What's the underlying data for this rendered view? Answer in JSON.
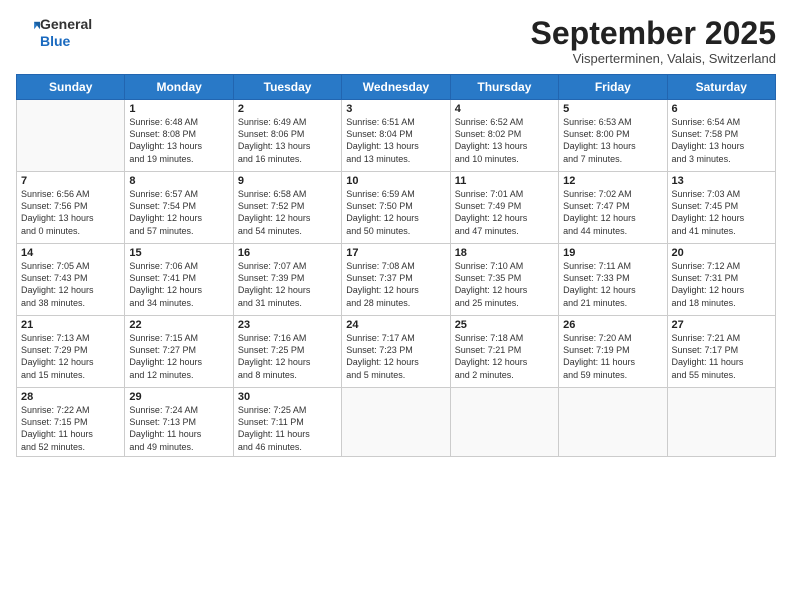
{
  "header": {
    "logo_general": "General",
    "logo_blue": "Blue",
    "month_title": "September 2025",
    "location": "Visperterminen, Valais, Switzerland"
  },
  "weekdays": [
    "Sunday",
    "Monday",
    "Tuesday",
    "Wednesday",
    "Thursday",
    "Friday",
    "Saturday"
  ],
  "weeks": [
    [
      {
        "day": "",
        "info": ""
      },
      {
        "day": "1",
        "info": "Sunrise: 6:48 AM\nSunset: 8:08 PM\nDaylight: 13 hours\nand 19 minutes."
      },
      {
        "day": "2",
        "info": "Sunrise: 6:49 AM\nSunset: 8:06 PM\nDaylight: 13 hours\nand 16 minutes."
      },
      {
        "day": "3",
        "info": "Sunrise: 6:51 AM\nSunset: 8:04 PM\nDaylight: 13 hours\nand 13 minutes."
      },
      {
        "day": "4",
        "info": "Sunrise: 6:52 AM\nSunset: 8:02 PM\nDaylight: 13 hours\nand 10 minutes."
      },
      {
        "day": "5",
        "info": "Sunrise: 6:53 AM\nSunset: 8:00 PM\nDaylight: 13 hours\nand 7 minutes."
      },
      {
        "day": "6",
        "info": "Sunrise: 6:54 AM\nSunset: 7:58 PM\nDaylight: 13 hours\nand 3 minutes."
      }
    ],
    [
      {
        "day": "7",
        "info": "Sunrise: 6:56 AM\nSunset: 7:56 PM\nDaylight: 13 hours\nand 0 minutes."
      },
      {
        "day": "8",
        "info": "Sunrise: 6:57 AM\nSunset: 7:54 PM\nDaylight: 12 hours\nand 57 minutes."
      },
      {
        "day": "9",
        "info": "Sunrise: 6:58 AM\nSunset: 7:52 PM\nDaylight: 12 hours\nand 54 minutes."
      },
      {
        "day": "10",
        "info": "Sunrise: 6:59 AM\nSunset: 7:50 PM\nDaylight: 12 hours\nand 50 minutes."
      },
      {
        "day": "11",
        "info": "Sunrise: 7:01 AM\nSunset: 7:49 PM\nDaylight: 12 hours\nand 47 minutes."
      },
      {
        "day": "12",
        "info": "Sunrise: 7:02 AM\nSunset: 7:47 PM\nDaylight: 12 hours\nand 44 minutes."
      },
      {
        "day": "13",
        "info": "Sunrise: 7:03 AM\nSunset: 7:45 PM\nDaylight: 12 hours\nand 41 minutes."
      }
    ],
    [
      {
        "day": "14",
        "info": "Sunrise: 7:05 AM\nSunset: 7:43 PM\nDaylight: 12 hours\nand 38 minutes."
      },
      {
        "day": "15",
        "info": "Sunrise: 7:06 AM\nSunset: 7:41 PM\nDaylight: 12 hours\nand 34 minutes."
      },
      {
        "day": "16",
        "info": "Sunrise: 7:07 AM\nSunset: 7:39 PM\nDaylight: 12 hours\nand 31 minutes."
      },
      {
        "day": "17",
        "info": "Sunrise: 7:08 AM\nSunset: 7:37 PM\nDaylight: 12 hours\nand 28 minutes."
      },
      {
        "day": "18",
        "info": "Sunrise: 7:10 AM\nSunset: 7:35 PM\nDaylight: 12 hours\nand 25 minutes."
      },
      {
        "day": "19",
        "info": "Sunrise: 7:11 AM\nSunset: 7:33 PM\nDaylight: 12 hours\nand 21 minutes."
      },
      {
        "day": "20",
        "info": "Sunrise: 7:12 AM\nSunset: 7:31 PM\nDaylight: 12 hours\nand 18 minutes."
      }
    ],
    [
      {
        "day": "21",
        "info": "Sunrise: 7:13 AM\nSunset: 7:29 PM\nDaylight: 12 hours\nand 15 minutes."
      },
      {
        "day": "22",
        "info": "Sunrise: 7:15 AM\nSunset: 7:27 PM\nDaylight: 12 hours\nand 12 minutes."
      },
      {
        "day": "23",
        "info": "Sunrise: 7:16 AM\nSunset: 7:25 PM\nDaylight: 12 hours\nand 8 minutes."
      },
      {
        "day": "24",
        "info": "Sunrise: 7:17 AM\nSunset: 7:23 PM\nDaylight: 12 hours\nand 5 minutes."
      },
      {
        "day": "25",
        "info": "Sunrise: 7:18 AM\nSunset: 7:21 PM\nDaylight: 12 hours\nand 2 minutes."
      },
      {
        "day": "26",
        "info": "Sunrise: 7:20 AM\nSunset: 7:19 PM\nDaylight: 11 hours\nand 59 minutes."
      },
      {
        "day": "27",
        "info": "Sunrise: 7:21 AM\nSunset: 7:17 PM\nDaylight: 11 hours\nand 55 minutes."
      }
    ],
    [
      {
        "day": "28",
        "info": "Sunrise: 7:22 AM\nSunset: 7:15 PM\nDaylight: 11 hours\nand 52 minutes."
      },
      {
        "day": "29",
        "info": "Sunrise: 7:24 AM\nSunset: 7:13 PM\nDaylight: 11 hours\nand 49 minutes."
      },
      {
        "day": "30",
        "info": "Sunrise: 7:25 AM\nSunset: 7:11 PM\nDaylight: 11 hours\nand 46 minutes."
      },
      {
        "day": "",
        "info": ""
      },
      {
        "day": "",
        "info": ""
      },
      {
        "day": "",
        "info": ""
      },
      {
        "day": "",
        "info": ""
      }
    ]
  ]
}
